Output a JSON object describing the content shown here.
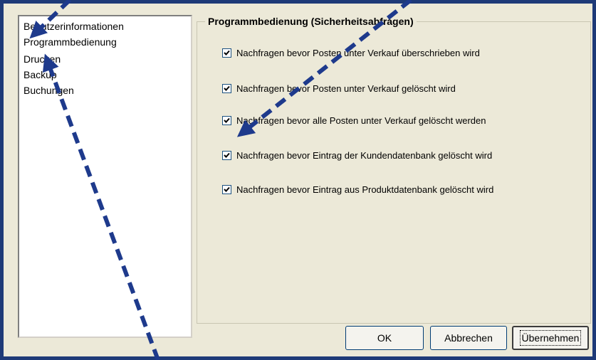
{
  "nav": {
    "items": [
      {
        "label": "Benutzerinformationen"
      },
      {
        "label": "Programmbedienung"
      },
      {
        "label": "Drucken"
      },
      {
        "label": "Backup"
      },
      {
        "label": "Buchungen"
      }
    ]
  },
  "group": {
    "title": "Programmbedienung (Sicherheitsabfragen)",
    "options": [
      {
        "label": "Nachfragen bevor Posten unter Verkauf überschrieben wird",
        "checked": true
      },
      {
        "label": "Nachfragen bevor Posten unter Verkauf gelöscht wird",
        "checked": true
      },
      {
        "label": "Nachfragen bevor alle Posten unter Verkauf gelöscht werden",
        "checked": true
      },
      {
        "label": "Nachfragen bevor Eintrag der Kundendatenbank gelöscht wird",
        "checked": true
      },
      {
        "label": "Nachfragen bevor Eintrag aus Produktdatenbank gelöscht wird",
        "checked": true
      }
    ]
  },
  "buttons": {
    "ok": "OK",
    "cancel": "Abbrechen",
    "apply": "Übernehmen"
  },
  "colors": {
    "border": "#1e3a78",
    "arrow": "#1e3a8c",
    "dialog_bg": "#ece9d8"
  }
}
